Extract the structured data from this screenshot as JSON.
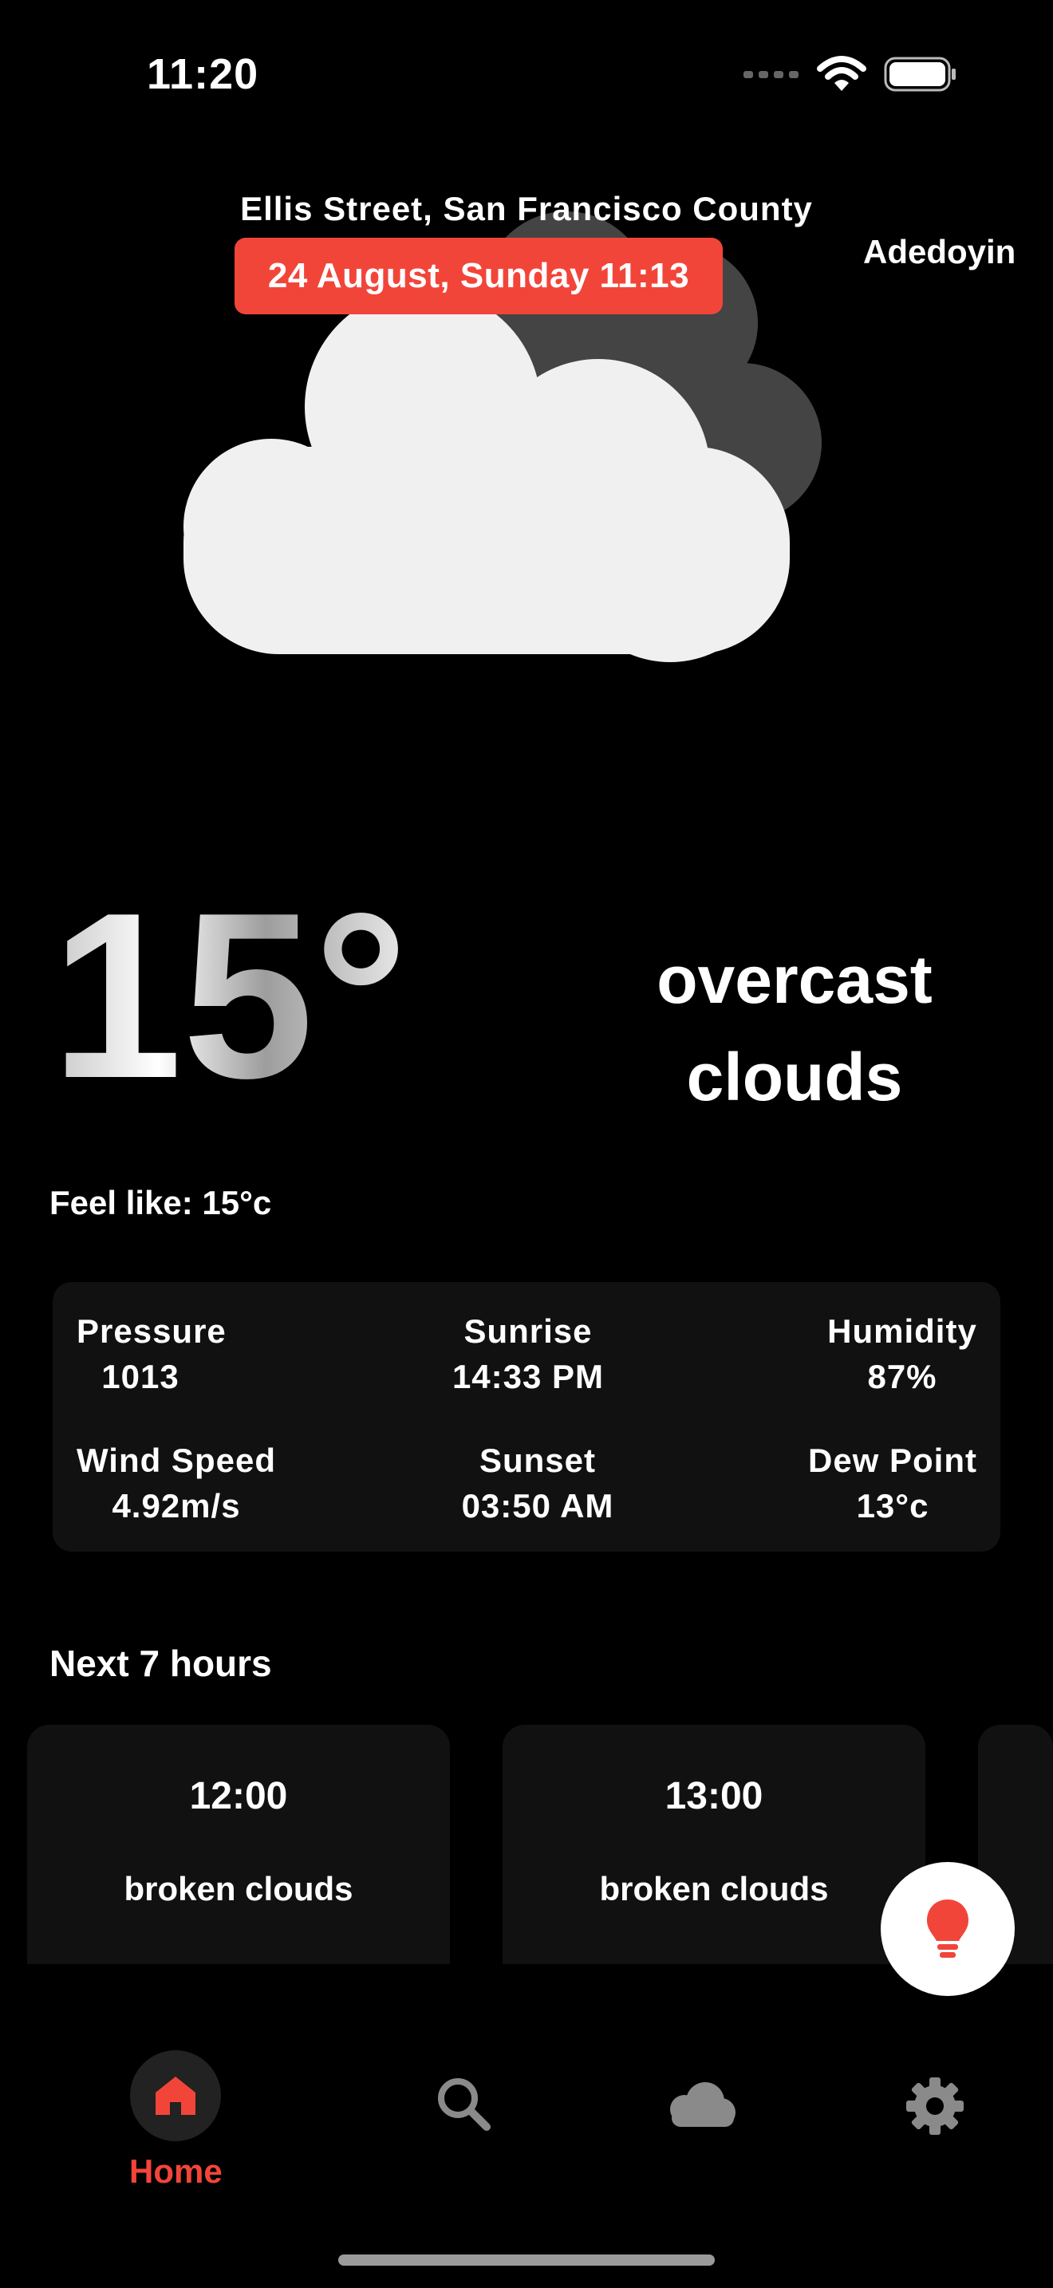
{
  "status_bar": {
    "time": "11:20"
  },
  "header": {
    "location": "Ellis Street, San Francisco County",
    "date": "24 August, Sunday 11:13",
    "user": "Adedoyin"
  },
  "current": {
    "temperature": "15°",
    "condition": "overcast clouds",
    "feels_like": "Feel like: 15°c"
  },
  "details": {
    "pressure_label": "Pressure",
    "pressure_value": "1013",
    "sunrise_label": "Sunrise",
    "sunrise_value": "14:33 PM",
    "humidity_label": "Humidity",
    "humidity_value": "87%",
    "wind_label": "Wind Speed",
    "wind_value": "4.92m/s",
    "sunset_label": "Sunset",
    "sunset_value": "03:50 AM",
    "dew_label": "Dew Point",
    "dew_value": "13°c"
  },
  "hourly": {
    "title": "Next 7 hours",
    "items": [
      {
        "time": "12:00",
        "description": "broken clouds"
      },
      {
        "time": "13:00",
        "description": "broken clouds"
      }
    ]
  },
  "nav": {
    "home_label": "Home",
    "active": "home",
    "items": [
      "home",
      "search",
      "cloud",
      "settings"
    ]
  },
  "colors": {
    "accent": "#f2453a",
    "background": "#000000",
    "card": "#111111"
  },
  "icons": {
    "fab": "lightbulb-icon",
    "weather": "overcast-clouds-icon"
  }
}
